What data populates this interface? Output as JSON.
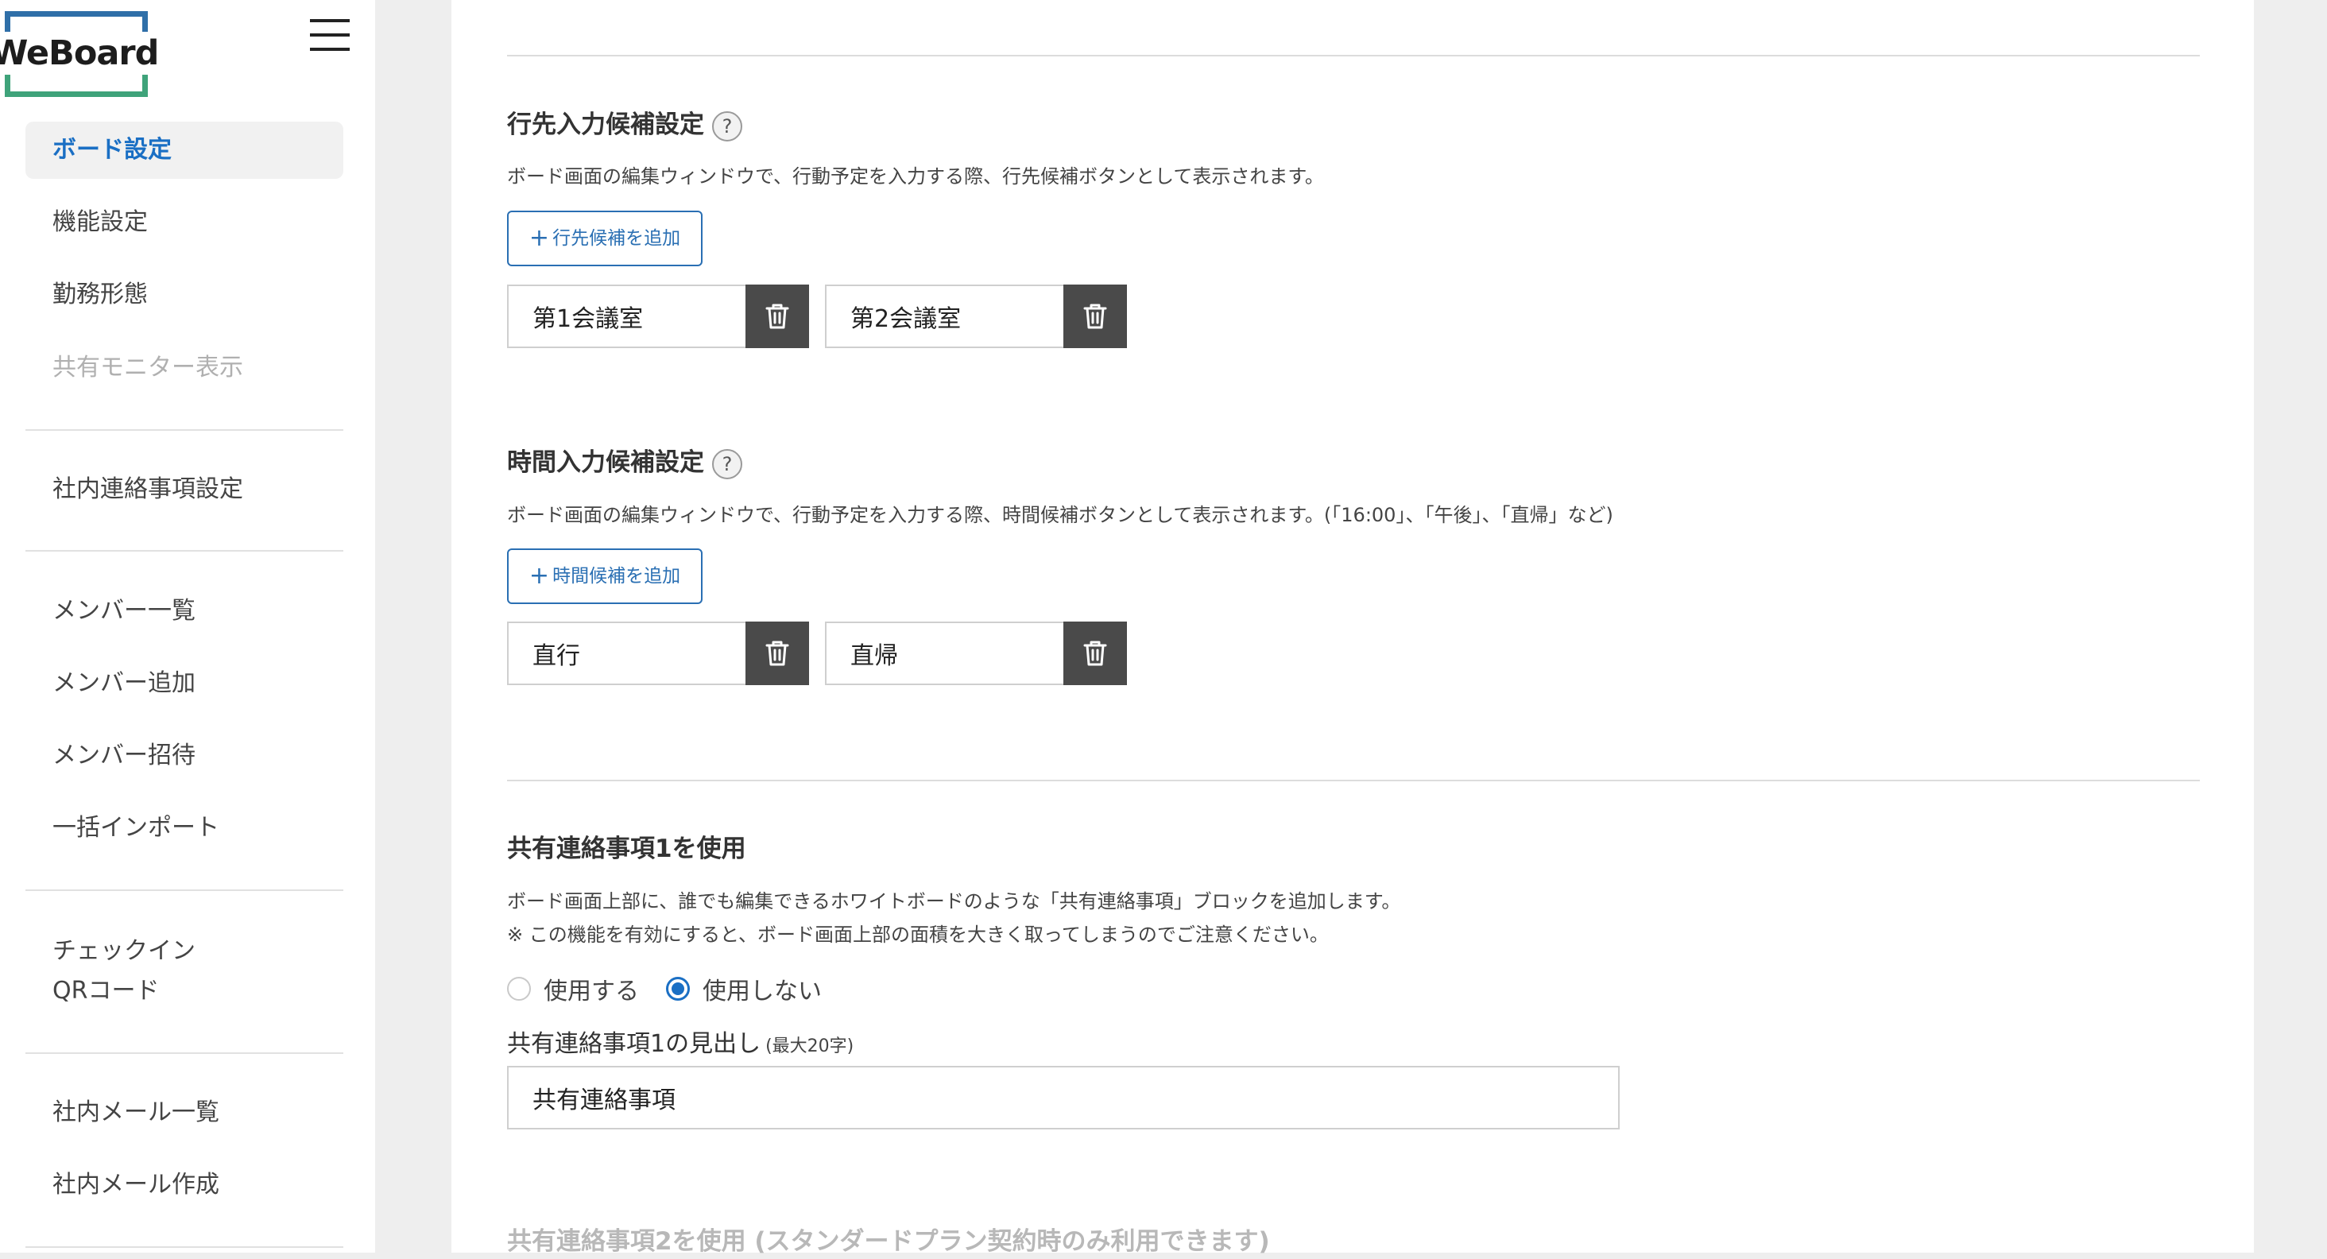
{
  "brand": {
    "logo_text": "WeBoard",
    "colors": {
      "accent": "#1a6fc4",
      "logo_top": "#2f6fa8",
      "logo_bottom": "#3fa37a",
      "delete_button": "#4a4a4a"
    }
  },
  "sidebar": {
    "menu_icon": "hamburger-icon",
    "items": [
      {
        "label": "ボード設定",
        "active": true
      },
      {
        "label": "機能設定"
      },
      {
        "label": "勤務形態"
      },
      {
        "label": "共有モニター表示",
        "disabled": true
      },
      {
        "label": "社内連絡事項設定"
      },
      {
        "label": "メンバー一覧"
      },
      {
        "label": "メンバー追加"
      },
      {
        "label": "メンバー招待"
      },
      {
        "label": "一括インポート"
      },
      {
        "label": "チェックイン\nQRコード"
      },
      {
        "label": "社内メール一覧"
      },
      {
        "label": "社内メール作成"
      }
    ]
  },
  "destination": {
    "title": "行先入力候補設定",
    "help": "?",
    "description": "ボード画面の編集ウィンドウで、行動予定を入力する際、行先候補ボタンとして表示されます。",
    "add_button": "行先候補を追加",
    "add_icon": "+",
    "candidates": [
      "第1会議室",
      "第2会議室"
    ],
    "delete_icon": "trash-icon"
  },
  "time": {
    "title": "時間入力候補設定",
    "help": "?",
    "description": "ボード画面の編集ウィンドウで、行動予定を入力する際、時間候補ボタンとして表示されます。(「16:00」、「午後」、「直帰」など)",
    "add_button": "時間候補を追加",
    "add_icon": "+",
    "candidates": [
      "直行",
      "直帰"
    ],
    "delete_icon": "trash-icon"
  },
  "shared1": {
    "title": "共有連絡事項1を使用",
    "description_line1": "ボード画面上部に、誰でも編集できるホワイトボードのような「共有連絡事項」ブロックを追加します。",
    "description_line2": "※ この機能を有効にすると、ボード画面上部の面積を大きく取ってしまうのでご注意ください。",
    "radio_use": "使用する",
    "radio_not_use": "使用しない",
    "selected": "使用しない",
    "heading_label": "共有連絡事項1の見出し",
    "heading_hint": "(最大20字)",
    "heading_value": "共有連絡事項"
  },
  "shared2": {
    "title": "共有連絡事項2を使用 (スタンダードプラン契約時のみ利用できます)"
  }
}
